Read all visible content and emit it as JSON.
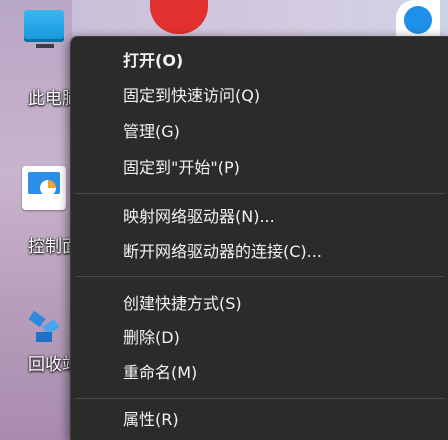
{
  "desktop": {
    "icons": [
      {
        "label": "此电脑",
        "icon": "computer-icon"
      },
      {
        "label": "控制面板",
        "icon": "control-panel-icon"
      },
      {
        "label": "回收站",
        "icon": "recycle-bin-icon"
      }
    ]
  },
  "context_menu": {
    "items": [
      {
        "label": "打开(O)"
      },
      {
        "label": "固定到快速访问(Q)"
      },
      {
        "label": "管理(G)"
      },
      {
        "label": "固定到\"开始\"(P)"
      },
      {
        "label": "映射网络驱动器(N)..."
      },
      {
        "label": "断开网络驱动器的连接(C)..."
      },
      {
        "label": "创建快捷方式(S)"
      },
      {
        "label": "删除(D)"
      },
      {
        "label": "重命名(M)"
      },
      {
        "label": "属性(R)"
      }
    ]
  },
  "colors": {
    "menu_background": "#2b2b2b",
    "menu_text": "#f2f2f2",
    "separator": "#4a4a4a"
  }
}
